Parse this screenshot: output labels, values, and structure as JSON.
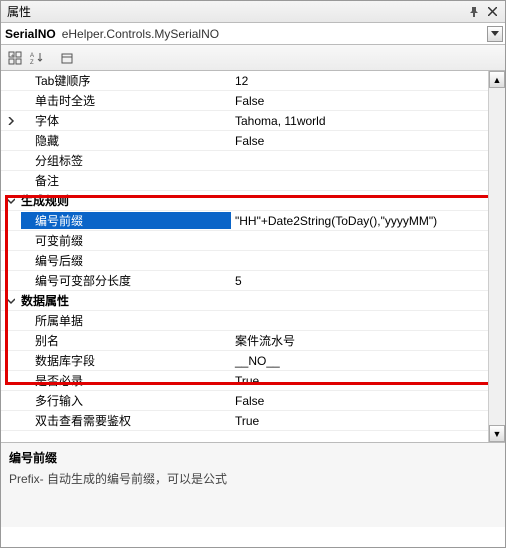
{
  "titlebar": {
    "title": "属性"
  },
  "selector": {
    "name": "SerialNO",
    "type": "eHelper.Controls.MySerialNO"
  },
  "rows": [
    {
      "kind": "prop",
      "indent": 1,
      "label": "Tab键顺序",
      "value": "12"
    },
    {
      "kind": "prop",
      "indent": 1,
      "label": "单击时全选",
      "value": "False"
    },
    {
      "kind": "prop",
      "indent": 1,
      "label": "字体",
      "value": "Tahoma, 11world",
      "expander": ">"
    },
    {
      "kind": "prop",
      "indent": 1,
      "label": "隐藏",
      "value": "False"
    },
    {
      "kind": "prop",
      "indent": 1,
      "label": "分组标签",
      "value": ""
    },
    {
      "kind": "prop",
      "indent": 1,
      "label": "备注",
      "value": ""
    },
    {
      "kind": "cat",
      "label": "生成规则",
      "expander": "v"
    },
    {
      "kind": "prop",
      "indent": 1,
      "label": "编号前缀",
      "value": "\"HH\"+Date2String(ToDay(),\"yyyyMM\")",
      "selected": true
    },
    {
      "kind": "prop",
      "indent": 1,
      "label": "可变前缀",
      "value": ""
    },
    {
      "kind": "prop",
      "indent": 1,
      "label": "编号后缀",
      "value": ""
    },
    {
      "kind": "prop",
      "indent": 1,
      "label": "编号可变部分长度",
      "value": "5"
    },
    {
      "kind": "cat",
      "label": "数据属性",
      "expander": "v"
    },
    {
      "kind": "prop",
      "indent": 1,
      "label": "所属单据",
      "value": ""
    },
    {
      "kind": "prop",
      "indent": 1,
      "label": "别名",
      "value": "案件流水号"
    },
    {
      "kind": "prop",
      "indent": 1,
      "label": "数据库字段",
      "value": "__NO__"
    },
    {
      "kind": "prop",
      "indent": 1,
      "label": "是否必录",
      "value": "True"
    },
    {
      "kind": "prop",
      "indent": 1,
      "label": "多行输入",
      "value": "False"
    },
    {
      "kind": "prop",
      "indent": 1,
      "label": "双击查看需要鉴权",
      "value": "True"
    }
  ],
  "description": {
    "title": "编号前缀",
    "text": "Prefix- 自动生成的编号前缀，可以是公式"
  }
}
